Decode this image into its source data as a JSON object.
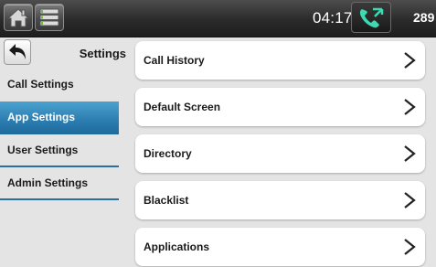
{
  "topbar": {
    "home_icon": "home-icon",
    "menu_icon": "menu-icon",
    "time": "04:17pm",
    "line_icon": "phone-handset-icon",
    "extension": "289"
  },
  "sidebar": {
    "back_icon": "back-arrow-icon",
    "title": "Settings",
    "items": [
      {
        "label": "Call Settings"
      },
      {
        "label": "App Settings",
        "selected": true
      },
      {
        "label": "User Settings"
      },
      {
        "label": "Admin Settings"
      }
    ]
  },
  "main": {
    "rows": [
      {
        "label": "Call History"
      },
      {
        "label": "Default Screen"
      },
      {
        "label": "Directory"
      },
      {
        "label": "Blacklist"
      },
      {
        "label": "Applications"
      }
    ],
    "chevron_icon": "chevron-right-icon"
  },
  "colors": {
    "topbar": "#2a2a2a",
    "selected_nav": "#2b7cb0",
    "phone_icon": "#3fd8b0",
    "background": "#e4e4e4"
  }
}
